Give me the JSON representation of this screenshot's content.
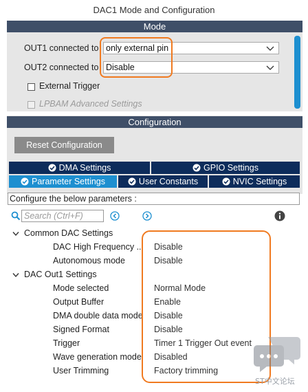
{
  "window": {
    "title": "DAC1 Mode and Configuration"
  },
  "mode": {
    "header": "Mode",
    "out1_label": "OUT1 connected to",
    "out1_value": "only external pin",
    "out2_label": "OUT2 connected to",
    "out2_value": "Disable",
    "external_trigger_label": "External Trigger",
    "lpbam_label": "LPBAM Advanced Settings"
  },
  "configuration": {
    "header": "Configuration",
    "reset_button": "Reset Configuration",
    "tabs": {
      "dma": "DMA Settings",
      "gpio": "GPIO Settings",
      "parameter": "Parameter Settings",
      "user_constants": "User Constants",
      "nvic": "NVIC Settings"
    },
    "hint": "Configure the below parameters :",
    "search_placeholder": "Search (Ctrl+F)",
    "groups": [
      {
        "name": "Common DAC Settings",
        "params": [
          {
            "label": "DAC High Frequency ...",
            "value": "Disable"
          },
          {
            "label": "Autonomous mode",
            "value": "Disable"
          }
        ]
      },
      {
        "name": "DAC Out1 Settings",
        "params": [
          {
            "label": "Mode selected",
            "value": "Normal Mode"
          },
          {
            "label": "Output Buffer",
            "value": "Enable"
          },
          {
            "label": "DMA double data mode",
            "value": "Disable"
          },
          {
            "label": "Signed Format",
            "value": "Disable"
          },
          {
            "label": "Trigger",
            "value": "Timer 1 Trigger Out event"
          },
          {
            "label": "Wave generation mode",
            "value": "Disabled"
          },
          {
            "label": "User Trimming",
            "value": "Factory trimming"
          }
        ]
      }
    ]
  },
  "watermark": {
    "text": "ST中文论坛"
  },
  "colors": {
    "header_bg": "#3f4f68",
    "tab_bg": "#0d2c5b",
    "tab_active": "#1d8fd0",
    "highlight": "#f07a20"
  }
}
